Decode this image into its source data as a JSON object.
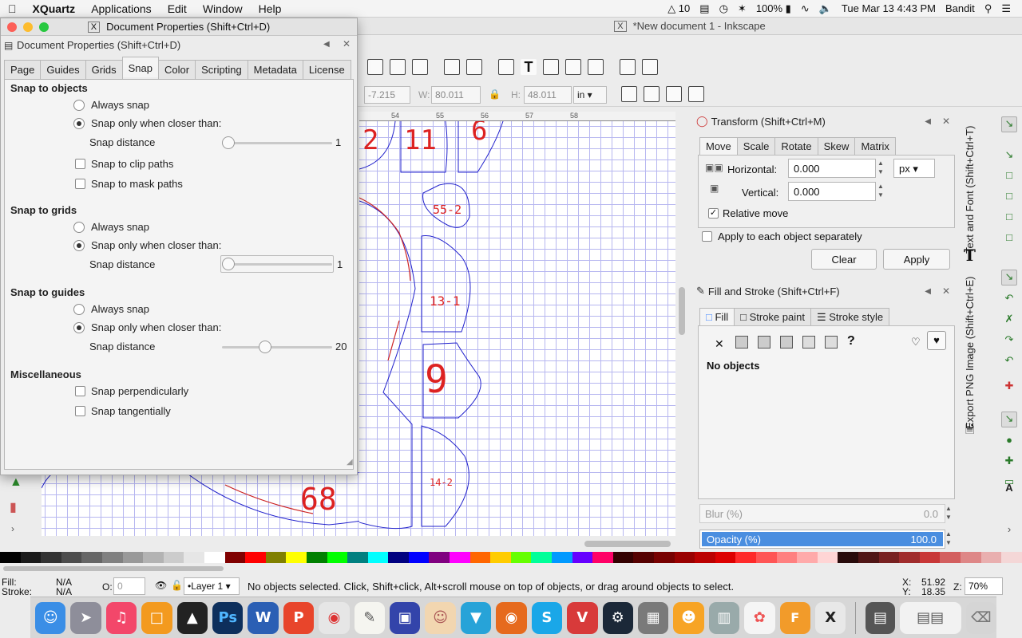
{
  "menubar": {
    "apple_icon": "apple-logo",
    "app_name": "XQuartz",
    "items": [
      "Applications",
      "Edit",
      "Window",
      "Help"
    ],
    "status": {
      "adobe_count": "10",
      "battery": "100%",
      "datetime": "Tue Mar 13  4:43 PM",
      "user": "Bandit"
    }
  },
  "inkscape": {
    "window_title": "*New document 1 - Inkscape",
    "toolbar": {
      "x_value": "-7.215",
      "w_label": "W:",
      "w_value": "80.011",
      "h_label": "H:",
      "h_value": "48.011",
      "unit": "in"
    },
    "ruler_labels": [
      "54",
      "55",
      "56",
      "57",
      "58"
    ],
    "canvas_labels": [
      "2",
      "11",
      "6",
      "55-2",
      "13-1",
      "9",
      "14-2",
      "68"
    ]
  },
  "transform": {
    "title": "Transform (Shift+Ctrl+M)",
    "tabs": [
      "Move",
      "Scale",
      "Rotate",
      "Skew",
      "Matrix"
    ],
    "active_tab": "Move",
    "horizontal_label": "Horizontal:",
    "horizontal_value": "0.000",
    "vertical_label": "Vertical:",
    "vertical_value": "0.000",
    "unit": "px",
    "relative_move_label": "Relative move",
    "relative_move_checked": true,
    "apply_each_label": "Apply to each object separately",
    "apply_each_checked": false,
    "clear_label": "Clear",
    "apply_label": "Apply"
  },
  "fill_stroke": {
    "title": "Fill and Stroke (Shift+Ctrl+F)",
    "tabs": [
      "Fill",
      "Stroke paint",
      "Stroke style"
    ],
    "active_tab": "Fill",
    "no_objects": "No objects",
    "blur_label": "Blur (%)",
    "blur_value": "0.0",
    "opacity_label": "Opacity (%)",
    "opacity_value": "100.0",
    "opacity_fraction": 1.0
  },
  "side_tabs": [
    "Text and Font (Shift+Ctrl+T)",
    "Export PNG Image (Shift+Ctrl+E)"
  ],
  "status_bar": {
    "fill_label": "Fill:",
    "fill_value": "N/A",
    "stroke_label": "Stroke:",
    "stroke_value": "N/A",
    "opacity_label": "O:",
    "opacity_value": "0",
    "layer": "•Layer 1",
    "message": "No objects selected. Click, Shift+click, Alt+scroll mouse on top of objects, or drag around objects to select.",
    "x_label": "X:",
    "x_value": "51.92",
    "y_label": "Y:",
    "y_value": "18.35",
    "zoom_label": "Z:",
    "zoom_value": "70%"
  },
  "doc_props": {
    "window_title": "Document Properties (Shift+Ctrl+D)",
    "header": "Document Properties (Shift+Ctrl+D)",
    "tabs": [
      "Page",
      "Guides",
      "Grids",
      "Snap",
      "Color",
      "Scripting",
      "Metadata",
      "License"
    ],
    "active_tab": "Snap",
    "sections": {
      "objects": {
        "title": "Snap to objects",
        "always": "Always snap",
        "closer": "Snap only when closer than:",
        "distance_label": "Snap distance",
        "distance_value": "1",
        "clip": "Snap to clip paths",
        "mask": "Snap to mask paths"
      },
      "grids": {
        "title": "Snap to grids",
        "always": "Always snap",
        "closer": "Snap only when closer than:",
        "distance_label": "Snap distance",
        "distance_value": "1"
      },
      "guides": {
        "title": "Snap to guides",
        "always": "Always snap",
        "closer": "Snap only when closer than:",
        "distance_label": "Snap distance",
        "distance_value": "20"
      },
      "misc": {
        "title": "Miscellaneous",
        "perpendicular": "Snap perpendicularly",
        "tangential": "Snap tangentially"
      }
    }
  },
  "palette_colors": [
    "#000000",
    "#1a1a1a",
    "#333333",
    "#4d4d4d",
    "#666666",
    "#808080",
    "#999999",
    "#b3b3b3",
    "#cccccc",
    "#e6e6e6",
    "#ffffff",
    "#800000",
    "#ff0000",
    "#808000",
    "#ffff00",
    "#008000",
    "#00ff00",
    "#008080",
    "#00ffff",
    "#000080",
    "#0000ff",
    "#800080",
    "#ff00ff",
    "#ff6600",
    "#ffcc00",
    "#66ff00",
    "#00ff99",
    "#0099ff",
    "#6600ff",
    "#ff0066",
    "#330000",
    "#550000",
    "#770000",
    "#990000",
    "#bb0000",
    "#dd0000",
    "#ff2a2a",
    "#ff5555",
    "#ff8080",
    "#ffaaaa",
    "#ffd5d5",
    "#280b0b",
    "#501616",
    "#782121",
    "#a02c2c",
    "#c83737",
    "#d35f5f",
    "#de8787",
    "#e9afaf",
    "#f4d7d7"
  ],
  "os_dock": [
    "Finder",
    "Launchpad",
    "Music",
    "Books",
    "Inkscape",
    "Photoshop",
    "Word",
    "WPS",
    "Chrome",
    "TextEdit",
    "Preview",
    "Paint",
    "Vectorize",
    "Firefox",
    "Skype",
    "Vivaldi",
    "Steam",
    "Calculator",
    "Scratch",
    "Scanner",
    "Photos",
    "Fusion 360",
    "X11",
    "Stickies",
    "Trash"
  ]
}
